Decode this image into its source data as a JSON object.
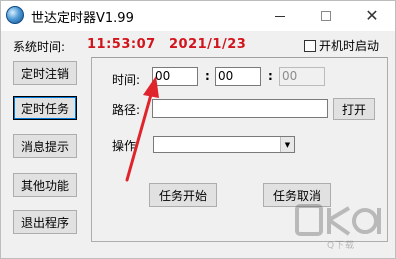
{
  "window": {
    "title": "世达定时器V1.99",
    "icon": "globe-icon"
  },
  "status": {
    "system_time_label": "系统时间:",
    "time": "11:53:07",
    "date": "2021/1/23",
    "autostart_label": "开机时启动",
    "autostart_checked": false,
    "accent_color": "#d2151d"
  },
  "sidebar": {
    "items": [
      {
        "label": "定时注销"
      },
      {
        "label": "定时任务"
      },
      {
        "label": "消息提示"
      },
      {
        "label": "其他功能"
      },
      {
        "label": "退出程序"
      }
    ],
    "selected": "定时任务"
  },
  "task": {
    "time_label": "时间:",
    "hour": "00",
    "minute": "00",
    "second": "00",
    "path_label": "路径:",
    "path_value": "",
    "open_label": "打开",
    "action_label": "操作",
    "action_value": "",
    "start_label": "任务开始",
    "cancel_label": "任务取消"
  },
  "watermark": {
    "text": "Q下载"
  }
}
